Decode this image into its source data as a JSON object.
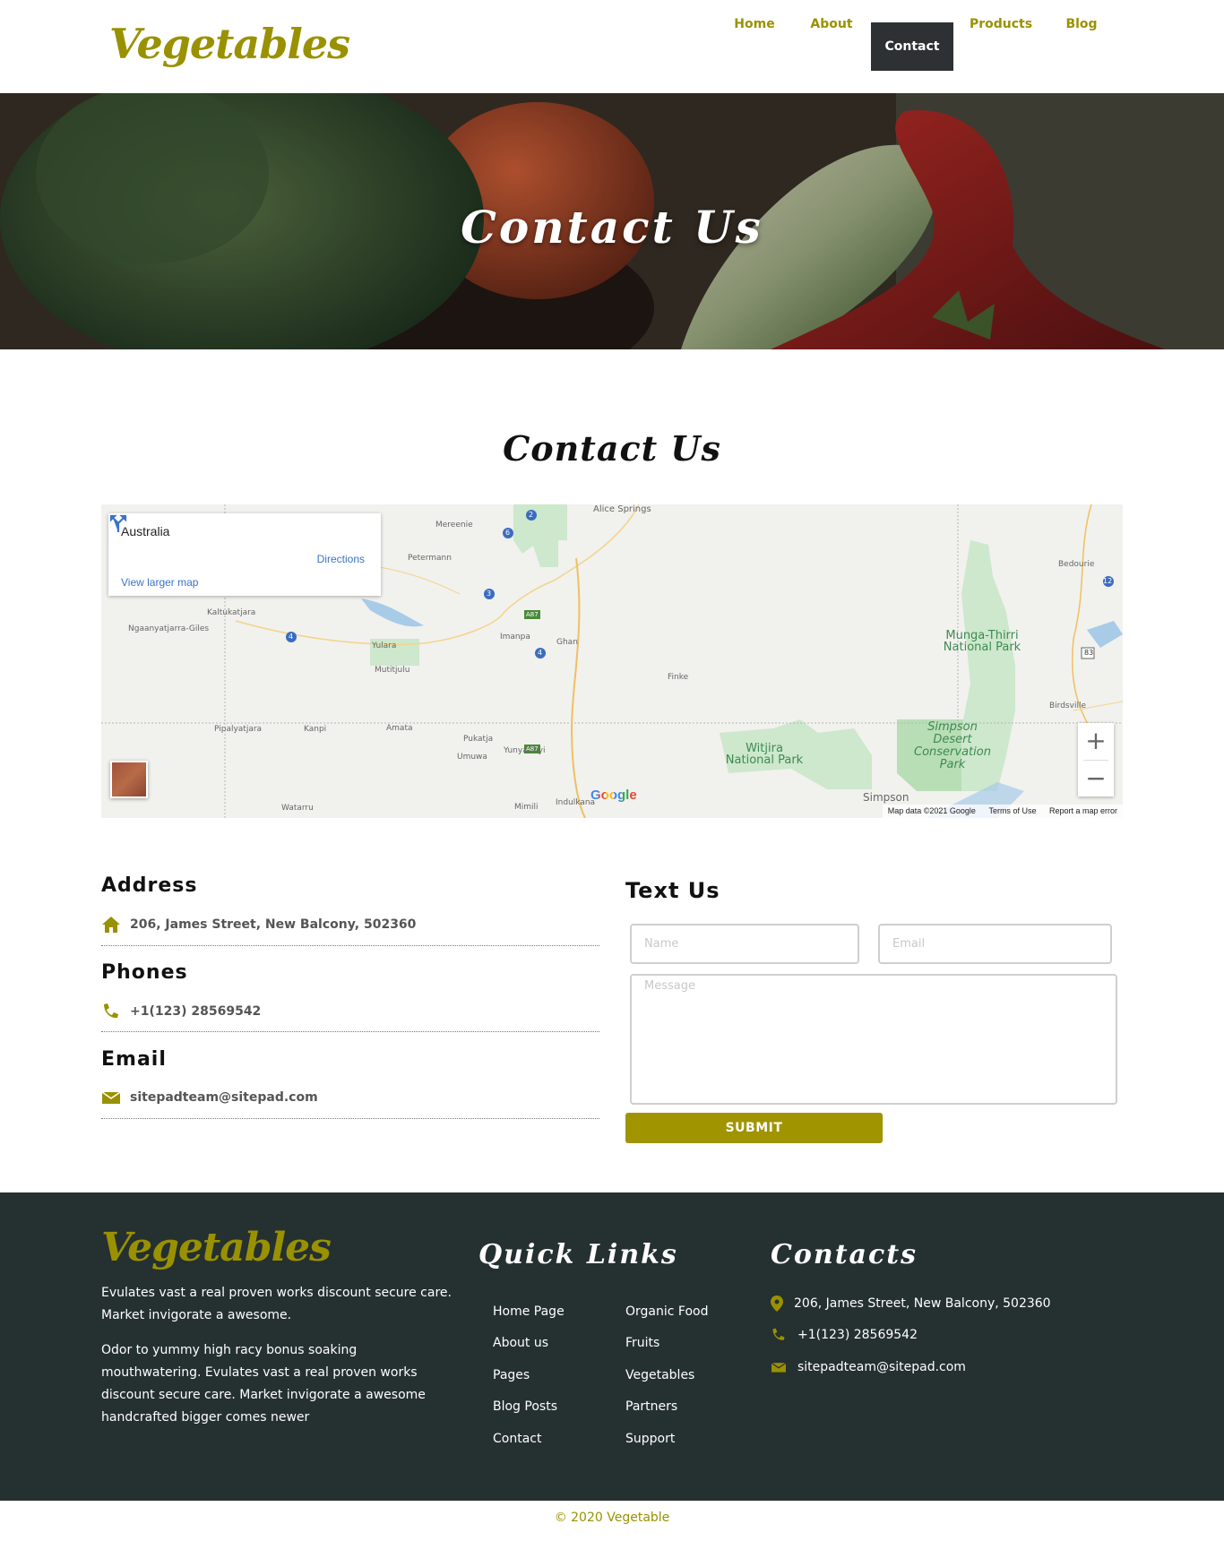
{
  "header": {
    "logo": "Vegetables",
    "nav": [
      {
        "label": "Home",
        "active": false
      },
      {
        "label": "About",
        "active": false
      },
      {
        "label": "Contact",
        "active": true
      },
      {
        "label": "Products",
        "active": false
      },
      {
        "label": "Blog",
        "active": false
      }
    ]
  },
  "hero": {
    "title": "Contact Us"
  },
  "section": {
    "title": "Contact Us"
  },
  "map": {
    "place": "Australia",
    "directions": "Directions",
    "larger_map": "View larger map",
    "labels": {
      "alice_springs": "Alice Springs",
      "mereenie": "Mereenie",
      "petermann": "Petermann",
      "kaltukatjara": "Kaltukatjara",
      "ngaanyatjarra": "Ngaanyatjarra-Giles",
      "yulara": "Yulara",
      "mutitjulu": "Mutitjulu",
      "imanpa": "Imanpa",
      "ghan": "Ghan",
      "finke": "Finke",
      "pipalyatjara": "Pipalyatjara",
      "kanpi": "Kanpi",
      "amata": "Amata",
      "pukatja": "Pukatja",
      "umuwa": "Umuwa",
      "yunyarinyi": "Yunyarinyi",
      "watarru": "Watarru",
      "mimili": "Mimili",
      "indulkana": "Indulkana",
      "bedourie": "Bedourie",
      "birdsville": "Birdsville",
      "simpson": "Simpson",
      "munga_thirri_1": "Munga-Thirri",
      "munga_thirri_2": "National Park",
      "witjira_1": "Witjira",
      "witjira_2": "National Park",
      "simpson_desert_1": "Simpson",
      "simpson_desert_2": "Desert",
      "simpson_desert_3": "Conservation",
      "simpson_desert_4": "Park",
      "a87": "A87",
      "a87_2": "A87",
      "r83": "83",
      "r12": "12",
      "r2": "2",
      "r6": "6",
      "r3": "3",
      "r4": "4",
      "r4b": "4"
    },
    "google": "Google",
    "footer": {
      "data": "Map data ©2021 Google",
      "terms": "Terms of Use",
      "report": "Report a map error"
    },
    "zoom_in": "+",
    "zoom_out": "−"
  },
  "contact_info": {
    "address_heading": "Address",
    "address": "206, James Street, New Balcony, 502360",
    "phones_heading": "Phones",
    "phone": "+1(123) 28569542",
    "email_heading": "Email",
    "email": "sitepadteam@sitepad.com"
  },
  "form": {
    "heading": "Text Us",
    "name_placeholder": "Name",
    "email_placeholder": "Email",
    "message_placeholder": "Message",
    "submit": "SUBMIT"
  },
  "footer": {
    "logo": "Vegetables",
    "para1": "Evulates vast a real proven works discount secure care. Market invigorate a awesome.",
    "para2": "Odor to yummy high racy bonus soaking mouthwatering. Evulates vast a real proven works discount secure care. Market invigorate a awesome handcrafted bigger comes newer",
    "quick_links_heading": "Quick Links",
    "links_col1": [
      "Home Page",
      "About us",
      "Pages",
      "Blog Posts",
      "Contact"
    ],
    "links_col2": [
      "Organic Food",
      "Fruits",
      "Vegetables",
      "Partners",
      "Support"
    ],
    "contacts_heading": "Contacts",
    "address": "206, James Street, New Balcony, 502360",
    "phone": "+1(123) 28569542",
    "email": "sitepadteam@sitepad.com"
  },
  "copyright": "© 2020 Vegetable",
  "colors": {
    "brand": "#9a9100",
    "button": "#a09400",
    "footer_bg": "#253031",
    "nav_active_bg": "#2e3133"
  },
  "icons": {
    "address": "home-icon",
    "phone": "phone-icon",
    "email": "envelope-icon",
    "footer_address": "map-pin-icon",
    "directions": "directions-icon"
  }
}
